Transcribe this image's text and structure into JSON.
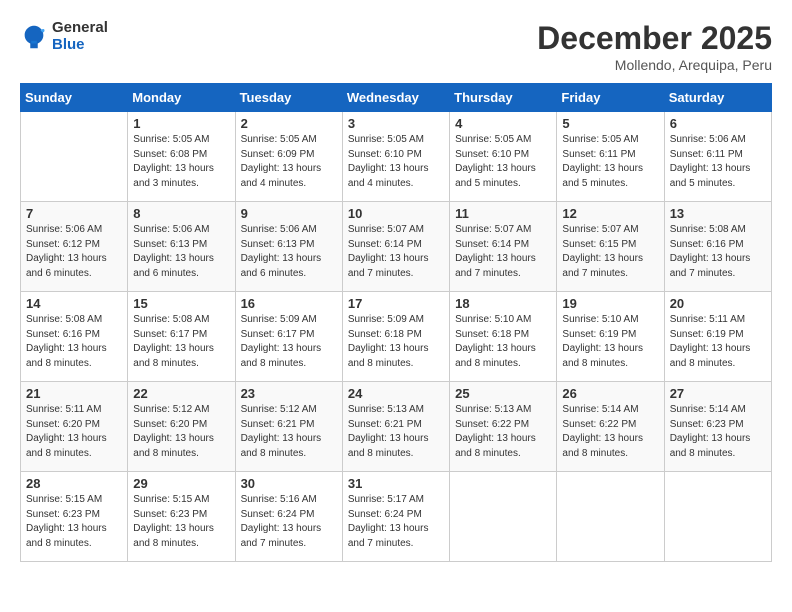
{
  "header": {
    "logo_general": "General",
    "logo_blue": "Blue",
    "month_title": "December 2025",
    "location": "Mollendo, Arequipa, Peru"
  },
  "weekdays": [
    "Sunday",
    "Monday",
    "Tuesday",
    "Wednesday",
    "Thursday",
    "Friday",
    "Saturday"
  ],
  "weeks": [
    [
      {
        "day": "",
        "info": ""
      },
      {
        "day": "1",
        "info": "Sunrise: 5:05 AM\nSunset: 6:08 PM\nDaylight: 13 hours\nand 3 minutes."
      },
      {
        "day": "2",
        "info": "Sunrise: 5:05 AM\nSunset: 6:09 PM\nDaylight: 13 hours\nand 4 minutes."
      },
      {
        "day": "3",
        "info": "Sunrise: 5:05 AM\nSunset: 6:10 PM\nDaylight: 13 hours\nand 4 minutes."
      },
      {
        "day": "4",
        "info": "Sunrise: 5:05 AM\nSunset: 6:10 PM\nDaylight: 13 hours\nand 5 minutes."
      },
      {
        "day": "5",
        "info": "Sunrise: 5:05 AM\nSunset: 6:11 PM\nDaylight: 13 hours\nand 5 minutes."
      },
      {
        "day": "6",
        "info": "Sunrise: 5:06 AM\nSunset: 6:11 PM\nDaylight: 13 hours\nand 5 minutes."
      }
    ],
    [
      {
        "day": "7",
        "info": "Sunrise: 5:06 AM\nSunset: 6:12 PM\nDaylight: 13 hours\nand 6 minutes."
      },
      {
        "day": "8",
        "info": "Sunrise: 5:06 AM\nSunset: 6:13 PM\nDaylight: 13 hours\nand 6 minutes."
      },
      {
        "day": "9",
        "info": "Sunrise: 5:06 AM\nSunset: 6:13 PM\nDaylight: 13 hours\nand 6 minutes."
      },
      {
        "day": "10",
        "info": "Sunrise: 5:07 AM\nSunset: 6:14 PM\nDaylight: 13 hours\nand 7 minutes."
      },
      {
        "day": "11",
        "info": "Sunrise: 5:07 AM\nSunset: 6:14 PM\nDaylight: 13 hours\nand 7 minutes."
      },
      {
        "day": "12",
        "info": "Sunrise: 5:07 AM\nSunset: 6:15 PM\nDaylight: 13 hours\nand 7 minutes."
      },
      {
        "day": "13",
        "info": "Sunrise: 5:08 AM\nSunset: 6:16 PM\nDaylight: 13 hours\nand 7 minutes."
      }
    ],
    [
      {
        "day": "14",
        "info": "Sunrise: 5:08 AM\nSunset: 6:16 PM\nDaylight: 13 hours\nand 8 minutes."
      },
      {
        "day": "15",
        "info": "Sunrise: 5:08 AM\nSunset: 6:17 PM\nDaylight: 13 hours\nand 8 minutes."
      },
      {
        "day": "16",
        "info": "Sunrise: 5:09 AM\nSunset: 6:17 PM\nDaylight: 13 hours\nand 8 minutes."
      },
      {
        "day": "17",
        "info": "Sunrise: 5:09 AM\nSunset: 6:18 PM\nDaylight: 13 hours\nand 8 minutes."
      },
      {
        "day": "18",
        "info": "Sunrise: 5:10 AM\nSunset: 6:18 PM\nDaylight: 13 hours\nand 8 minutes."
      },
      {
        "day": "19",
        "info": "Sunrise: 5:10 AM\nSunset: 6:19 PM\nDaylight: 13 hours\nand 8 minutes."
      },
      {
        "day": "20",
        "info": "Sunrise: 5:11 AM\nSunset: 6:19 PM\nDaylight: 13 hours\nand 8 minutes."
      }
    ],
    [
      {
        "day": "21",
        "info": "Sunrise: 5:11 AM\nSunset: 6:20 PM\nDaylight: 13 hours\nand 8 minutes."
      },
      {
        "day": "22",
        "info": "Sunrise: 5:12 AM\nSunset: 6:20 PM\nDaylight: 13 hours\nand 8 minutes."
      },
      {
        "day": "23",
        "info": "Sunrise: 5:12 AM\nSunset: 6:21 PM\nDaylight: 13 hours\nand 8 minutes."
      },
      {
        "day": "24",
        "info": "Sunrise: 5:13 AM\nSunset: 6:21 PM\nDaylight: 13 hours\nand 8 minutes."
      },
      {
        "day": "25",
        "info": "Sunrise: 5:13 AM\nSunset: 6:22 PM\nDaylight: 13 hours\nand 8 minutes."
      },
      {
        "day": "26",
        "info": "Sunrise: 5:14 AM\nSunset: 6:22 PM\nDaylight: 13 hours\nand 8 minutes."
      },
      {
        "day": "27",
        "info": "Sunrise: 5:14 AM\nSunset: 6:23 PM\nDaylight: 13 hours\nand 8 minutes."
      }
    ],
    [
      {
        "day": "28",
        "info": "Sunrise: 5:15 AM\nSunset: 6:23 PM\nDaylight: 13 hours\nand 8 minutes."
      },
      {
        "day": "29",
        "info": "Sunrise: 5:15 AM\nSunset: 6:23 PM\nDaylight: 13 hours\nand 8 minutes."
      },
      {
        "day": "30",
        "info": "Sunrise: 5:16 AM\nSunset: 6:24 PM\nDaylight: 13 hours\nand 7 minutes."
      },
      {
        "day": "31",
        "info": "Sunrise: 5:17 AM\nSunset: 6:24 PM\nDaylight: 13 hours\nand 7 minutes."
      },
      {
        "day": "",
        "info": ""
      },
      {
        "day": "",
        "info": ""
      },
      {
        "day": "",
        "info": ""
      }
    ]
  ]
}
